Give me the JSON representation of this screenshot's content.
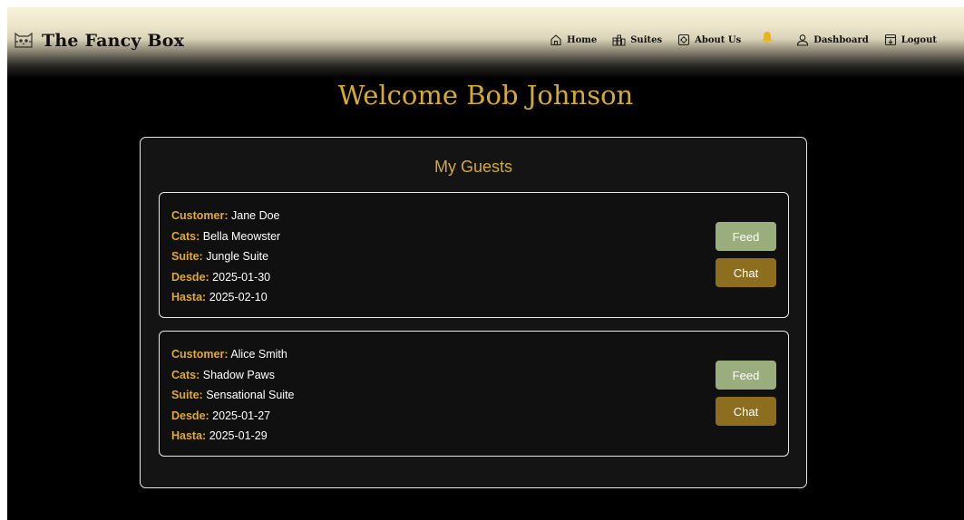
{
  "brand": {
    "title": "The Fancy Box",
    "icon": "cat-icon"
  },
  "nav": {
    "home": "Home",
    "suites": "Suites",
    "about": "About Us",
    "dashboard": "Dashboard",
    "logout": "Logout"
  },
  "page": {
    "welcome": "Welcome Bob Johnson"
  },
  "guests": {
    "title": "My Guests",
    "labels": {
      "customer": "Customer:",
      "cats": "Cats:",
      "suite": "Suite:",
      "desde": "Desde:",
      "hasta": "Hasta:"
    },
    "feed_label": "Feed",
    "chat_label": "Chat",
    "items": [
      {
        "customer": "Jane Doe",
        "cats": "Bella Meowster",
        "suite": "Jungle Suite",
        "desde": "2025-01-30",
        "hasta": "2025-02-10"
      },
      {
        "customer": "Alice Smith",
        "cats": "Shadow Paws",
        "suite": "Sensational Suite",
        "desde": "2025-01-27",
        "hasta": "2025-01-29"
      }
    ]
  },
  "colors": {
    "accent_gold": "#d6a92f",
    "label_gold": "#e0a92c",
    "feed_button": "#9aad7c",
    "chat_button": "#8c6e1e",
    "bell": "#e6b422"
  }
}
